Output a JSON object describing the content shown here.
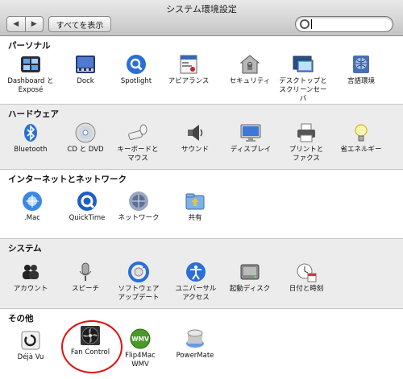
{
  "window": {
    "title": "システム環境設定"
  },
  "toolbar": {
    "back_label": "◀",
    "forward_label": "▶",
    "show_all_label": "すべてを表示",
    "search_value": ""
  },
  "sections": {
    "personal": {
      "title": "パーソナル",
      "items": [
        {
          "label": "Dashboard と\nExposé",
          "icon": "dashboard-expose-icon"
        },
        {
          "label": "Dock",
          "icon": "dock-icon"
        },
        {
          "label": "Spotlight",
          "icon": "spotlight-icon"
        },
        {
          "label": "アピアランス",
          "icon": "appearance-icon"
        },
        {
          "label": "セキュリティ",
          "icon": "security-icon"
        },
        {
          "label": "デスクトップと\nスクリーンセーバ",
          "icon": "desktop-screensaver-icon"
        },
        {
          "label": "言語環境",
          "icon": "international-icon"
        }
      ]
    },
    "hardware": {
      "title": "ハードウェア",
      "items": [
        {
          "label": "Bluetooth",
          "icon": "bluetooth-icon"
        },
        {
          "label": "CD と DVD",
          "icon": "cd-dvd-icon"
        },
        {
          "label": "キーボードと\nマウス",
          "icon": "keyboard-mouse-icon"
        },
        {
          "label": "サウンド",
          "icon": "sound-icon"
        },
        {
          "label": "ディスプレイ",
          "icon": "display-icon"
        },
        {
          "label": "プリントと\nファクス",
          "icon": "print-fax-icon"
        },
        {
          "label": "省エネルギー",
          "icon": "energy-saver-icon"
        }
      ]
    },
    "internet": {
      "title": "インターネットとネットワーク",
      "items": [
        {
          "label": ".Mac",
          "icon": "dotmac-icon"
        },
        {
          "label": "QuickTime",
          "icon": "quicktime-icon"
        },
        {
          "label": "ネットワーク",
          "icon": "network-icon"
        },
        {
          "label": "共有",
          "icon": "sharing-icon"
        }
      ]
    },
    "system": {
      "title": "システム",
      "items": [
        {
          "label": "アカウント",
          "icon": "accounts-icon"
        },
        {
          "label": "スピーチ",
          "icon": "speech-icon"
        },
        {
          "label": "ソフトウェア\nアップデート",
          "icon": "software-update-icon"
        },
        {
          "label": "ユニバーサル\nアクセス",
          "icon": "universal-access-icon"
        },
        {
          "label": "起動ディスク",
          "icon": "startup-disk-icon"
        },
        {
          "label": "日付と時刻",
          "icon": "date-time-icon"
        }
      ]
    },
    "other": {
      "title": "その他",
      "items": [
        {
          "label": "Déjà Vu",
          "icon": "deja-vu-icon"
        },
        {
          "label": "Fan Control",
          "icon": "fan-control-icon"
        },
        {
          "label": "Flip4Mac\nWMV",
          "icon": "flip4mac-icon"
        },
        {
          "label": "PowerMate",
          "icon": "powermate-icon"
        }
      ]
    }
  },
  "colors": {
    "highlight_circle": "#e01010",
    "accent_blue": "#2a6fd6"
  }
}
